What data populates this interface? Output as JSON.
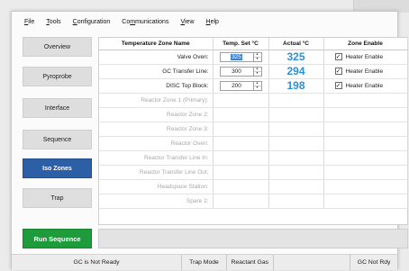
{
  "menu": [
    {
      "label": "File",
      "key": "F"
    },
    {
      "label": "Tools",
      "key": "T"
    },
    {
      "label": "Configuration",
      "key": "C"
    },
    {
      "label": "Communications",
      "key": "m"
    },
    {
      "label": "View",
      "key": "V"
    },
    {
      "label": "Help",
      "key": "H"
    }
  ],
  "nav": [
    {
      "label": "Overview",
      "active": false
    },
    {
      "label": "Pyroprobe",
      "active": false
    },
    {
      "label": "Interface",
      "active": false
    },
    {
      "label": "Sequence",
      "active": false
    },
    {
      "label": "Iso Zones",
      "active": true
    },
    {
      "label": "Trap",
      "active": false
    }
  ],
  "table": {
    "headers": [
      "Temperature Zone Name",
      "Temp. Set °C",
      "Actual °C",
      "Zone Enable"
    ],
    "rows": [
      {
        "name": "Valve Oven:",
        "set": "325",
        "actual": "325",
        "enable_label": "Heater Enable",
        "enabled": true,
        "selected": true
      },
      {
        "name": "GC Transfer Line:",
        "set": "300",
        "actual": "294",
        "enable_label": "Heater Enable",
        "enabled": true
      },
      {
        "name": "DISC Top Block:",
        "set": "200",
        "actual": "198",
        "enable_label": "Heater Enable",
        "enabled": true
      },
      {
        "name": "Reactor Zone 1 (Primary):",
        "disabled": true
      },
      {
        "name": "Reactor Zone 2:",
        "disabled": true
      },
      {
        "name": "Reactor Zone 3:",
        "disabled": true
      },
      {
        "name": "Reactor Oven:",
        "disabled": true
      },
      {
        "name": "Reactor Transfer Line In:",
        "disabled": true
      },
      {
        "name": "Reactor Transfer Line Out:",
        "disabled": true
      },
      {
        "name": "Headspace Station:",
        "disabled": true
      },
      {
        "name": "Spare 2:",
        "disabled": true
      }
    ]
  },
  "run_button": "Run Sequence",
  "status": [
    "GC is Not Ready",
    "Trap Mode",
    "Reactant Gas",
    "",
    "GC Not Rdy"
  ],
  "colors": {
    "accent": "#2d5fa6",
    "run": "#1e9c3b",
    "actual": "#2b8fd8"
  }
}
